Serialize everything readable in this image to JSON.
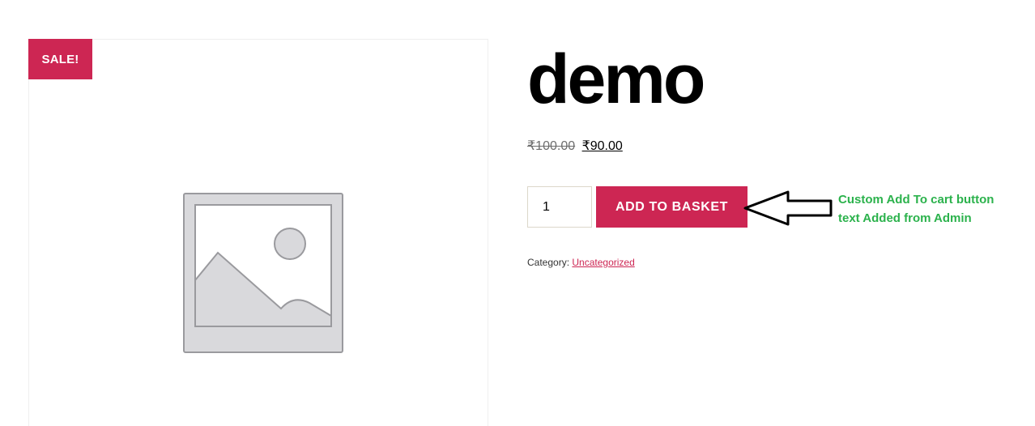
{
  "product": {
    "title": "demo",
    "sale_badge": "SALE!",
    "price_old": "₹100.00",
    "price_new": "₹90.00",
    "quantity": "1",
    "add_to_cart_label": "ADD TO BASKET",
    "category_label": "Category:",
    "category_value": "Uncategorized",
    "image_icon": "image-placeholder-icon"
  },
  "annotation": {
    "line1": "Custom Add To cart button",
    "line2": "text Added from Admin",
    "arrow_icon": "left-arrow-icon"
  },
  "colors": {
    "accent": "#cd2653",
    "annotation_text": "#2bb24c"
  }
}
